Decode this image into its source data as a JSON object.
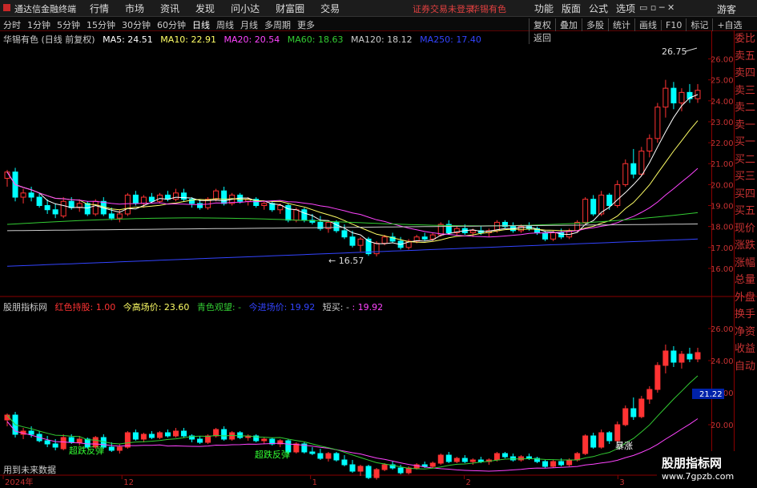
{
  "titlebar": {
    "app_name": "通达信金融终端",
    "menu": [
      "行情",
      "市场",
      "资讯",
      "发现",
      "问小达",
      "财富圈",
      "交易"
    ],
    "warning": "证券交易未登录",
    "stock": "华锡有色",
    "right_menu": [
      "功能",
      "版面",
      "公式",
      "选项"
    ],
    "guest": "游客"
  },
  "periodbar": {
    "periods": [
      "分时",
      "1分钟",
      "5分钟",
      "15分钟",
      "30分钟",
      "60分钟",
      "日线",
      "周线",
      "月线",
      "多周期",
      "更多"
    ],
    "active": "日线",
    "tools": [
      "复权",
      "叠加",
      "多股",
      "统计",
      "画线",
      "F10",
      "标记",
      "+自选",
      "返回"
    ]
  },
  "main_info": {
    "stock_label": "华锡有色 (日线 前复权)",
    "ma5": "MA5: 24.51",
    "ma10": "MA10: 22.91",
    "ma20": "MA20: 20.54",
    "ma60": "MA60: 18.63",
    "ma120": "MA120: 18.12",
    "ma250": "MA250: 17.40"
  },
  "sub_info": {
    "indicator": "股朋指标网",
    "red_hold": "红色持股: 1.00",
    "high_price": "今高场价: 23.60",
    "cyan_watch": "青色观望: -",
    "near_line": "今进场价: 19.92",
    "short_buy": "短买: -",
    "short_val": ": 19.92"
  },
  "price_axis": [
    "26.00",
    "25.00",
    "24.00",
    "23.00",
    "22.00",
    "21.00",
    "20.00",
    "19.00",
    "18.00",
    "17.00",
    "16.00"
  ],
  "sub_axis": [
    "26.00",
    "24.00",
    "22.00",
    "20.00",
    "18.00"
  ],
  "current_price_tag": "21.22",
  "annotations": {
    "high": "26.75",
    "low": "← 16.57",
    "rebound1": "超跌反弹",
    "rebound2": "超跌反弹",
    "surge": "暴涨",
    "future_data": "用到未来数据"
  },
  "date_axis": [
    "2024年",
    "12",
    "1",
    "2",
    "3"
  ],
  "right_panel": [
    "委比",
    "卖五",
    "卖四",
    "卖三",
    "卖二",
    "卖一",
    "买一",
    "买二",
    "买三",
    "买四",
    "买五",
    "现价",
    "涨跌",
    "涨幅",
    "总量",
    "外盘",
    "换手",
    "净资",
    "收益",
    "自动",
    "交易",
    "14:56",
    "14:56",
    "14:56",
    "14:56",
    "14:56",
    "14:56",
    "14:56",
    "14:56"
  ],
  "watermark": {
    "title": "股朋指标网",
    "url": "www.7gpzb.com"
  },
  "colors": {
    "up": "#ff3333",
    "down": "#00ffff",
    "ma5": "#ffffff",
    "ma10": "#ffff66",
    "ma20": "#ff44ff",
    "ma60": "#33cc33",
    "ma120": "#cccccc",
    "ma250": "#3344ff"
  },
  "chart_data": {
    "type": "candlestick",
    "ylim": [
      15.5,
      26.9
    ],
    "candles": [
      [
        20.3,
        20.7,
        19.9,
        20.6
      ],
      [
        20.6,
        20.8,
        19.2,
        19.4
      ],
      [
        19.4,
        19.8,
        19.1,
        19.6
      ],
      [
        19.6,
        19.9,
        19.2,
        19.4
      ],
      [
        19.4,
        19.6,
        18.9,
        19.0
      ],
      [
        19.0,
        19.3,
        18.6,
        18.8
      ],
      [
        18.8,
        19.1,
        18.4,
        18.6
      ],
      [
        18.5,
        19.4,
        18.4,
        19.2
      ],
      [
        19.2,
        19.4,
        18.8,
        18.9
      ],
      [
        18.9,
        19.3,
        18.7,
        19.1
      ],
      [
        19.1,
        19.2,
        18.5,
        18.6
      ],
      [
        18.6,
        19.3,
        18.5,
        19.2
      ],
      [
        19.2,
        19.4,
        18.5,
        18.6
      ],
      [
        18.6,
        18.9,
        18.3,
        18.4
      ],
      [
        18.4,
        18.8,
        18.2,
        18.6
      ],
      [
        18.6,
        19.6,
        18.5,
        19.5
      ],
      [
        19.5,
        19.7,
        19.0,
        19.1
      ],
      [
        19.1,
        19.5,
        18.9,
        19.4
      ],
      [
        19.4,
        19.6,
        19.1,
        19.2
      ],
      [
        19.2,
        19.6,
        19.1,
        19.5
      ],
      [
        19.5,
        19.7,
        19.2,
        19.3
      ],
      [
        19.3,
        19.8,
        19.2,
        19.6
      ],
      [
        19.6,
        19.8,
        19.2,
        19.3
      ],
      [
        19.3,
        19.4,
        18.9,
        19.1
      ],
      [
        19.1,
        19.3,
        18.8,
        18.9
      ],
      [
        18.9,
        19.4,
        18.8,
        19.3
      ],
      [
        19.3,
        19.8,
        19.2,
        19.7
      ],
      [
        19.7,
        19.9,
        19.0,
        19.1
      ],
      [
        19.1,
        19.6,
        19.0,
        19.5
      ],
      [
        19.5,
        19.6,
        19.1,
        19.2
      ],
      [
        19.2,
        19.4,
        19.0,
        19.3
      ],
      [
        19.3,
        19.4,
        18.9,
        19.0
      ],
      [
        19.0,
        19.2,
        18.8,
        19.1
      ],
      [
        19.1,
        19.2,
        18.7,
        18.8
      ],
      [
        18.8,
        19.1,
        18.6,
        19.0
      ],
      [
        19.0,
        19.1,
        18.2,
        18.3
      ],
      [
        18.3,
        18.9,
        18.2,
        18.8
      ],
      [
        18.8,
        18.9,
        18.2,
        18.3
      ],
      [
        18.3,
        18.6,
        18.1,
        18.2
      ],
      [
        18.2,
        18.5,
        17.8,
        17.9
      ],
      [
        17.9,
        18.3,
        17.7,
        18.2
      ],
      [
        18.2,
        18.3,
        17.7,
        17.8
      ],
      [
        17.8,
        18.1,
        17.4,
        17.5
      ],
      [
        17.5,
        17.8,
        17.0,
        17.1
      ],
      [
        17.1,
        17.5,
        16.8,
        17.4
      ],
      [
        17.4,
        17.5,
        16.6,
        16.7
      ],
      [
        16.7,
        17.3,
        16.57,
        17.2
      ],
      [
        17.2,
        17.6,
        17.1,
        17.5
      ],
      [
        17.5,
        17.7,
        17.2,
        17.3
      ],
      [
        17.3,
        17.5,
        16.9,
        17.0
      ],
      [
        17.0,
        17.4,
        16.9,
        17.3
      ],
      [
        17.3,
        17.6,
        17.2,
        17.5
      ],
      [
        17.5,
        17.7,
        17.3,
        17.4
      ],
      [
        17.4,
        17.7,
        17.3,
        17.6
      ],
      [
        17.6,
        18.2,
        17.5,
        18.1
      ],
      [
        18.1,
        18.3,
        17.6,
        17.7
      ],
      [
        17.7,
        18.0,
        17.6,
        17.9
      ],
      [
        17.9,
        18.1,
        17.6,
        17.7
      ],
      [
        17.7,
        17.9,
        17.5,
        17.8
      ],
      [
        17.8,
        18.0,
        17.6,
        17.7
      ],
      [
        17.7,
        17.9,
        17.5,
        17.8
      ],
      [
        17.8,
        18.3,
        17.7,
        18.2
      ],
      [
        18.2,
        18.3,
        17.9,
        18.0
      ],
      [
        18.0,
        18.2,
        17.7,
        17.8
      ],
      [
        17.8,
        18.1,
        17.7,
        18.0
      ],
      [
        18.0,
        18.2,
        17.8,
        17.9
      ],
      [
        17.9,
        18.0,
        17.6,
        17.7
      ],
      [
        17.7,
        17.8,
        17.3,
        17.4
      ],
      [
        17.4,
        17.8,
        17.3,
        17.7
      ],
      [
        17.7,
        17.9,
        17.4,
        17.5
      ],
      [
        17.5,
        17.9,
        17.4,
        17.8
      ],
      [
        17.8,
        18.3,
        17.7,
        18.2
      ],
      [
        18.2,
        19.4,
        18.1,
        19.3
      ],
      [
        19.3,
        19.5,
        18.5,
        18.6
      ],
      [
        18.6,
        19.7,
        18.5,
        19.5
      ],
      [
        19.5,
        19.6,
        18.8,
        19.0
      ],
      [
        19.0,
        20.2,
        18.9,
        20.0
      ],
      [
        20.0,
        21.2,
        19.9,
        21.0
      ],
      [
        21.0,
        21.7,
        20.3,
        20.5
      ],
      [
        20.5,
        21.8,
        20.4,
        21.6
      ],
      [
        21.6,
        22.4,
        21.3,
        22.2
      ],
      [
        22.2,
        23.9,
        22.0,
        23.7
      ],
      [
        23.7,
        25.0,
        23.2,
        24.6
      ],
      [
        24.6,
        24.9,
        23.6,
        23.9
      ],
      [
        23.9,
        24.6,
        23.5,
        24.4
      ],
      [
        24.4,
        24.8,
        23.9,
        24.1
      ],
      [
        24.1,
        24.8,
        23.9,
        24.5
      ]
    ],
    "ma5_last": 24.51,
    "ma10_last": 22.91,
    "ma20_last": 20.54,
    "ma60_last": 18.63,
    "ma120_last": 18.12,
    "ma250_last": 17.4
  }
}
